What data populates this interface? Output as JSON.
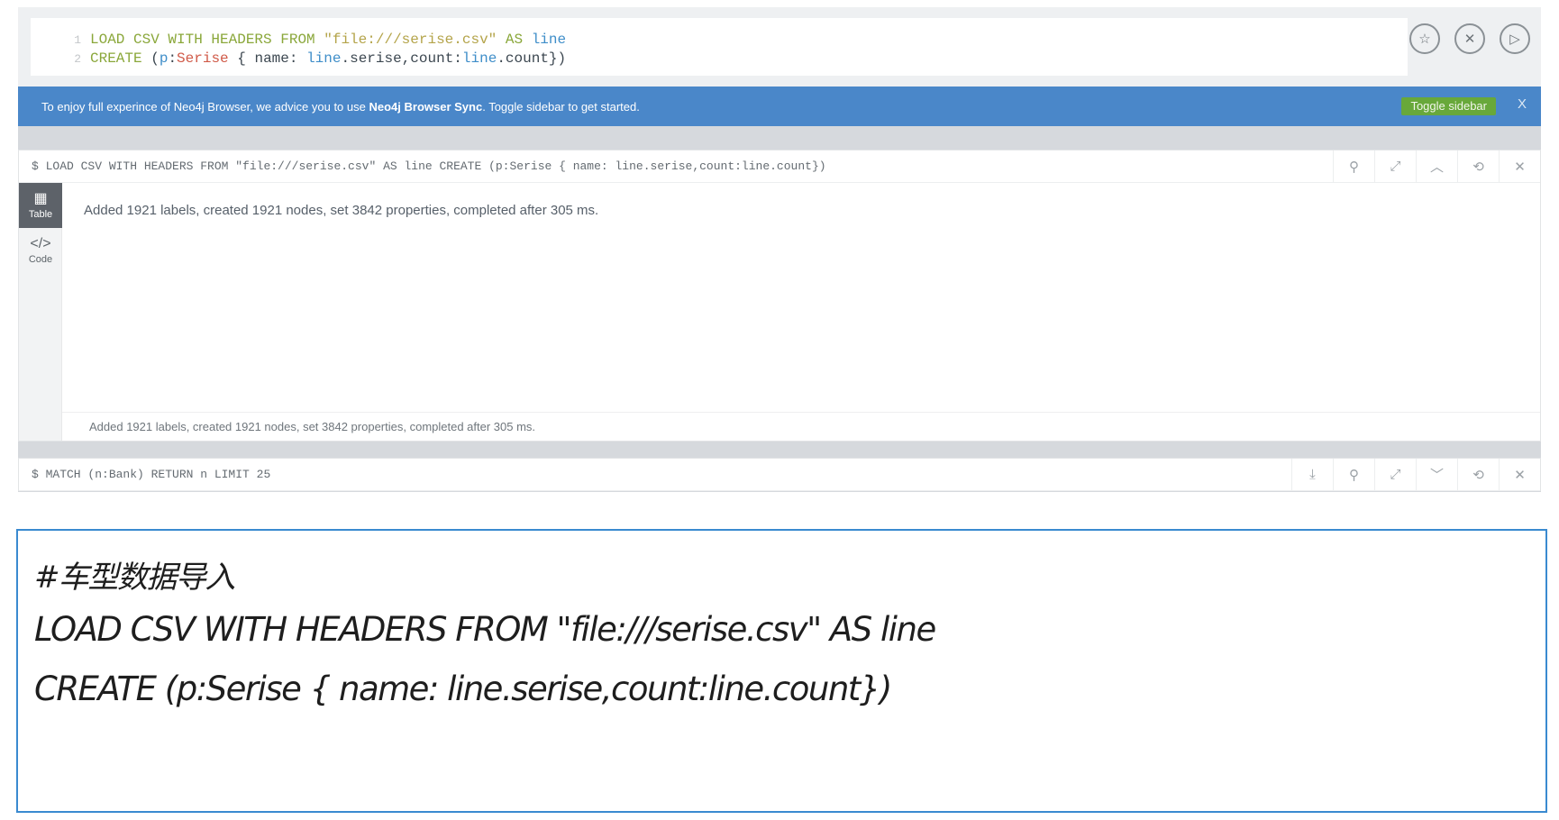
{
  "editor": {
    "line_numbers": [
      "1",
      "2"
    ],
    "line1": {
      "kw1": "LOAD CSV WITH HEADERS FROM",
      "str": "\"file:///serise.csv\"",
      "kw2": "AS",
      "var": "line"
    },
    "line2": {
      "kw": "CREATE",
      "p1": "(",
      "var1": "p",
      "p2": ":",
      "label": "Serise",
      "p3": " { name: ",
      "var2": "line",
      "p4": ".serise,count:",
      "var3": "line",
      "p5": ".count})"
    },
    "actions": [
      {
        "icon": "star-icon",
        "glyph": "☆"
      },
      {
        "icon": "clear-icon",
        "glyph": "✕"
      },
      {
        "icon": "play-icon",
        "glyph": "▷"
      }
    ]
  },
  "banner": {
    "text_before": "To enjoy full experince of Neo4j Browser, we advice you to use ",
    "link": "Neo4j Browser Sync",
    "text_after": ". Toggle sidebar to get started.",
    "button": "Toggle sidebar",
    "close": "X"
  },
  "frame1": {
    "command": "$ LOAD CSV WITH HEADERS FROM \"file:///serise.csv\" AS line CREATE (p:Serise { name: line.serise,count:line.count})",
    "tools": [
      {
        "icon": "pin-icon",
        "glyph": "⚲"
      },
      {
        "icon": "expand-icon",
        "glyph": "⤢"
      },
      {
        "icon": "collapse-up-icon",
        "glyph": "︿"
      },
      {
        "icon": "rerun-icon",
        "glyph": "⟲"
      },
      {
        "icon": "close-icon",
        "glyph": "✕"
      }
    ],
    "side": [
      {
        "label": "Table",
        "glyph": "▦"
      },
      {
        "label": "Code",
        "glyph": "</>"
      }
    ],
    "result": "Added 1921 labels, created 1921 nodes, set 3842 properties, completed after 305 ms.",
    "status": "Added 1921 labels, created 1921 nodes, set 3842 properties, completed after 305 ms."
  },
  "frame2": {
    "command": "$ MATCH (n:Bank) RETURN n LIMIT 25",
    "tools": [
      {
        "icon": "download-icon",
        "glyph": "⤓"
      },
      {
        "icon": "pin-icon",
        "glyph": "⚲"
      },
      {
        "icon": "expand-icon",
        "glyph": "⤢"
      },
      {
        "icon": "collapse-down-icon",
        "glyph": "﹀"
      },
      {
        "icon": "rerun-icon",
        "glyph": "⟲"
      },
      {
        "icon": "close-icon",
        "glyph": "✕"
      }
    ]
  },
  "notes": {
    "line1": "#车型数据导入",
    "line2": "LOAD CSV WITH HEADERS FROM \"file:///serise.csv\" AS line",
    "line3": "CREATE (p:Serise { name: line.serise,count:line.count})"
  }
}
